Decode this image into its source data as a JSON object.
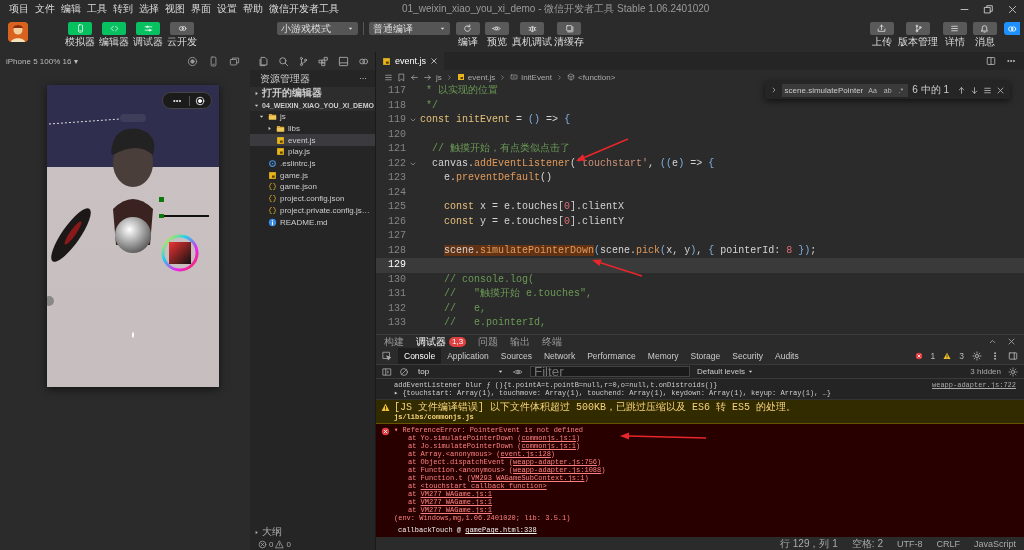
{
  "menu": [
    "项目",
    "文件",
    "编辑",
    "工具",
    "转到",
    "选择",
    "视图",
    "界面",
    "设置",
    "帮助",
    "微信开发者工具"
  ],
  "window": {
    "title": "01_weixin_xiao_you_xi_demo - 微信开发者工具 Stable 1.06.2401020"
  },
  "toolbar": {
    "views": [
      {
        "label": "模拟器",
        "on": true
      },
      {
        "label": "编辑器",
        "on": true
      },
      {
        "label": "调试器",
        "on": true
      },
      {
        "label": "云开发",
        "on": false
      }
    ],
    "mode": "小游戏模式",
    "compile": "普通编译",
    "actions": [
      "编译",
      "预览",
      "真机调试",
      "清缓存"
    ],
    "right_actions": [
      "上传",
      "版本管理",
      "详情",
      "消息"
    ]
  },
  "simulator": {
    "device": "iPhone 5 100% 16 ▾"
  },
  "explorer": {
    "title": "资源管理器",
    "more": "···",
    "sections": [
      {
        "label": "打开的编辑器",
        "expanded": false
      },
      {
        "label": "04_WEIXIN_XIAO_YOU_XI_DEMO",
        "expanded": true
      }
    ],
    "tree": [
      {
        "name": "js",
        "kind": "folder",
        "expanded": true,
        "selected": false,
        "children": [
          {
            "name": "libs",
            "kind": "folder",
            "expanded": false,
            "selected": false
          },
          {
            "name": "event.js",
            "kind": "js",
            "selected": true
          },
          {
            "name": "play.js",
            "kind": "js",
            "selected": false
          }
        ]
      },
      {
        "name": ".eslintrc.js",
        "kind": "eslint",
        "selected": false
      },
      {
        "name": "game.js",
        "kind": "js",
        "selected": false
      },
      {
        "name": "game.json",
        "kind": "json",
        "selected": false
      },
      {
        "name": "project.config.json",
        "kind": "json",
        "selected": false
      },
      {
        "name": "project.private.config.js…",
        "kind": "json",
        "selected": false
      },
      {
        "name": "README.md",
        "kind": "info",
        "selected": false
      }
    ],
    "outline": {
      "label": "大纲",
      "expanded": false
    },
    "problems": {
      "errors": "0",
      "warnings": "0"
    }
  },
  "editor": {
    "tabs": [
      {
        "label": "event.js",
        "selected": true
      }
    ],
    "breadcrumb": [
      {
        "label": "js",
        "kind": "folder"
      },
      {
        "label": "event.js",
        "kind": "file"
      },
      {
        "label": "initEvent",
        "kind": "variable"
      },
      {
        "label": "<function>",
        "kind": "function"
      }
    ],
    "find": {
      "query": "scene.simulatePointer",
      "options": [
        {
          "label": "Aa",
          "on": false
        },
        {
          "label": "ab",
          "on": false
        },
        {
          "label": ".*",
          "on": false
        }
      ],
      "result": "6 中的 1"
    },
    "lines": [
      {
        "number": "117",
        "current": false,
        "tokens": [
          {
            "text": " * 以实现的位置",
            "kind": "comment"
          }
        ]
      },
      {
        "number": "118",
        "current": false,
        "tokens": [
          {
            "text": " */",
            "kind": "comment"
          }
        ]
      },
      {
        "number": "119",
        "current": false,
        "fold": true,
        "tokens": [
          {
            "text": "const",
            "kind": "keyword"
          },
          {
            "text": " initEvent",
            "kind": "name"
          },
          {
            "text": " = ",
            "kind": "plain"
          },
          {
            "text": "()",
            "kind": "bracket"
          },
          {
            "text": " => ",
            "kind": "plain"
          },
          {
            "text": "{",
            "kind": "bracket"
          }
        ]
      },
      {
        "number": "120",
        "current": false
      },
      {
        "number": "121",
        "current": false,
        "tokens": [
          {
            "text": "  // 触摸开始，有点类似点击了",
            "kind": "comment"
          }
        ]
      },
      {
        "number": "122",
        "current": false,
        "fold": true,
        "tokens": [
          {
            "text": "  canvas.",
            "kind": "plain"
          },
          {
            "text": "addEventListener",
            "kind": "method"
          },
          {
            "text": "(",
            "kind": "plain"
          },
          {
            "text": "'touchstart'",
            "kind": "string"
          },
          {
            "text": ", ",
            "kind": "plain"
          },
          {
            "text": "((",
            "kind": "bracket"
          },
          {
            "text": "e",
            "kind": "plain"
          },
          {
            "text": ")",
            "kind": "bracket"
          },
          {
            "text": " => ",
            "kind": "plain"
          },
          {
            "text": "{",
            "kind": "bracket"
          }
        ]
      },
      {
        "number": "123",
        "current": false,
        "tokens": [
          {
            "text": "    e.",
            "kind": "plain"
          },
          {
            "text": "preventDefault",
            "kind": "method"
          },
          {
            "text": "()",
            "kind": "plain"
          }
        ]
      },
      {
        "number": "124",
        "current": false
      },
      {
        "number": "125",
        "current": false,
        "tokens": [
          {
            "text": "    const",
            "kind": "keyword"
          },
          {
            "text": " x = e.touches[",
            "kind": "plain"
          },
          {
            "text": "0",
            "kind": "number"
          },
          {
            "text": "].clientX",
            "kind": "plain"
          }
        ]
      },
      {
        "number": "126",
        "current": false,
        "tokens": [
          {
            "text": "    const",
            "kind": "keyword"
          },
          {
            "text": " y = e.touches[",
            "kind": "plain"
          },
          {
            "text": "0",
            "kind": "number"
          },
          {
            "text": "].clientY",
            "kind": "plain"
          }
        ]
      },
      {
        "number": "127",
        "current": false
      },
      {
        "number": "128",
        "current": false,
        "tokens": [
          {
            "text": "    scene.",
            "kind": "plain",
            "match": true
          },
          {
            "text": "simulatePointerDown",
            "kind": "method",
            "match": true
          },
          {
            "text": "(",
            "kind": "bracket"
          },
          {
            "text": "scene.",
            "kind": "plain"
          },
          {
            "text": "pick",
            "kind": "method"
          },
          {
            "text": "(",
            "kind": "bracket"
          },
          {
            "text": "x, y",
            "kind": "plain"
          },
          {
            "text": ")",
            "kind": "bracket"
          },
          {
            "text": ", ",
            "kind": "plain"
          },
          {
            "text": "{",
            "kind": "bracket"
          },
          {
            "text": " pointerId: ",
            "kind": "plain"
          },
          {
            "text": "8",
            "kind": "number"
          },
          {
            "text": " }",
            "kind": "bracket"
          },
          {
            "text": ")",
            "kind": "bracket"
          },
          {
            "text": ";",
            "kind": "plain"
          }
        ]
      },
      {
        "number": "129",
        "current": true
      },
      {
        "number": "130",
        "current": false,
        "tokens": [
          {
            "text": "    // console.log(",
            "kind": "comment"
          }
        ]
      },
      {
        "number": "131",
        "current": false,
        "tokens": [
          {
            "text": "    //   \"触摸开始 e.touches\",",
            "kind": "comment"
          }
        ]
      },
      {
        "number": "132",
        "current": false,
        "tokens": [
          {
            "text": "    //   e,",
            "kind": "comment"
          }
        ]
      },
      {
        "number": "133",
        "current": false,
        "tokens": [
          {
            "text": "    //   e.pointerId,",
            "kind": "comment"
          }
        ]
      }
    ]
  },
  "panel": {
    "tabs": [
      {
        "label": "构建",
        "selected": false
      },
      {
        "label": "调试器",
        "selected": true,
        "badge": "1,3"
      },
      {
        "label": "问题",
        "selected": false
      },
      {
        "label": "输出",
        "selected": false
      },
      {
        "label": "终端",
        "selected": false
      }
    ],
    "devtools_tabs": [
      {
        "label": "Console",
        "selected": true
      },
      {
        "label": "Application",
        "selected": false
      },
      {
        "label": "Sources",
        "selected": false
      },
      {
        "label": "Network",
        "selected": false
      },
      {
        "label": "Performance",
        "selected": false
      },
      {
        "label": "Memory",
        "selected": false
      },
      {
        "label": "Storage",
        "selected": false
      },
      {
        "label": "Security",
        "selected": false
      },
      {
        "label": "Audits",
        "selected": false
      }
    ],
    "counts": {
      "errors": "1",
      "warnings": "3"
    },
    "context": "top",
    "filter_placeholder": "Filter",
    "levels": "Default levels",
    "hidden": "3 hidden",
    "messages": [
      {
        "kind": "log",
        "source": "weapp-adapter.js:722",
        "lines": [
          {
            "text": "addEventListener blur ƒ (){t.pointA=t.pointB=null,r=0,o=null,t.onDistroids()}"
          },
          {
            "text": "▸ {touchstart: Array(1), touchmove: Array(1), touchend: Array(1), keydown: Array(1), keyup: Array(1), …}"
          }
        ]
      },
      {
        "kind": "warning",
        "lines": [
          {
            "text": "[JS 文件编译错误] 以下文件体积超过 500KB，已跳过压缩以及 ES6 转 ES5 的处理。"
          },
          {
            "text": "js/libs/commonjs.js"
          }
        ]
      },
      {
        "kind": "error",
        "lines": [
          {
            "text": "▾ ReferenceError: PointerEvent is not defined"
          },
          {
            "text": "at Yo.simulatePointerDown (",
            "link": "commonjs.js:1",
            "after": ")"
          },
          {
            "text": "at Jo.simulatePointerDown (",
            "link": "commonjs.js:1",
            "after": ")"
          },
          {
            "text": "at Array.<anonymous> (",
            "link": "event.js:128",
            "after": ")"
          },
          {
            "text": "at Object.dispatchEvent (",
            "link": "weapp-adapter.js:756",
            "after": ")"
          },
          {
            "text": "at Function.<anonymous> (",
            "link": "weapp-adapter.js:1088",
            "after": ")"
          },
          {
            "text": "at Function.t (",
            "link": "VM293 WAGameSubContext.js:1",
            "after": ")"
          },
          {
            "text": "at ",
            "link": "<touchstart callback function>"
          },
          {
            "text": "at ",
            "link": "VM277 WAGame.js:1"
          },
          {
            "text": "at ",
            "link": "VM277 WAGame.js:1"
          },
          {
            "text": "at ",
            "link": "VM277 WAGame.js:1"
          },
          {
            "text": "(env: Windows,mg,1.06.2401020; lib: 3.5.1)"
          }
        ]
      },
      {
        "kind": "call",
        "lines": [
          {
            "text": "callbackTouch @ ",
            "link": "gamePage.html:338"
          }
        ]
      }
    ]
  },
  "status_bar": [
    "行 129，列 1",
    "空格: 2",
    "UTF-8",
    "CRLF",
    "JavaScript"
  ]
}
